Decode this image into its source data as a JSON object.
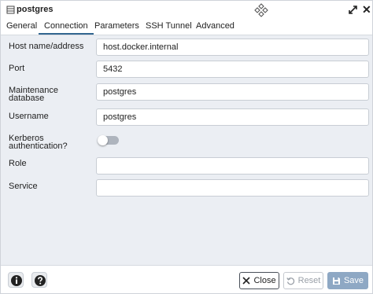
{
  "window": {
    "title": "postgres"
  },
  "tabs": [
    {
      "label": "General",
      "active": false
    },
    {
      "label": "Connection",
      "active": true
    },
    {
      "label": "Parameters",
      "active": false
    },
    {
      "label": "SSH Tunnel",
      "active": false
    },
    {
      "label": "Advanced",
      "active": false
    }
  ],
  "form": {
    "host": {
      "label": "Host name/address",
      "value": "host.docker.internal"
    },
    "port": {
      "label": "Port",
      "value": "5432"
    },
    "maintenance_db": {
      "label_line1": "Maintenance",
      "label_line2": "database",
      "value": "postgres"
    },
    "username": {
      "label": "Username",
      "value": "postgres"
    },
    "kerberos": {
      "label_line1": "Kerberos",
      "label_line2": "authentication?",
      "enabled": false
    },
    "role": {
      "label": "Role",
      "value": ""
    },
    "service": {
      "label": "Service",
      "value": ""
    }
  },
  "footer": {
    "close_label": "Close",
    "reset_label": "Reset",
    "save_label": "Save"
  },
  "colors": {
    "accent": "#326690",
    "save_button": "#8ea8c4",
    "panel_bg": "#ebeef3"
  },
  "icons": [
    "database-icon",
    "move-icon",
    "expand-icon",
    "close-icon",
    "info-icon",
    "help-icon",
    "close-x-icon",
    "reset-icon",
    "save-icon"
  ]
}
